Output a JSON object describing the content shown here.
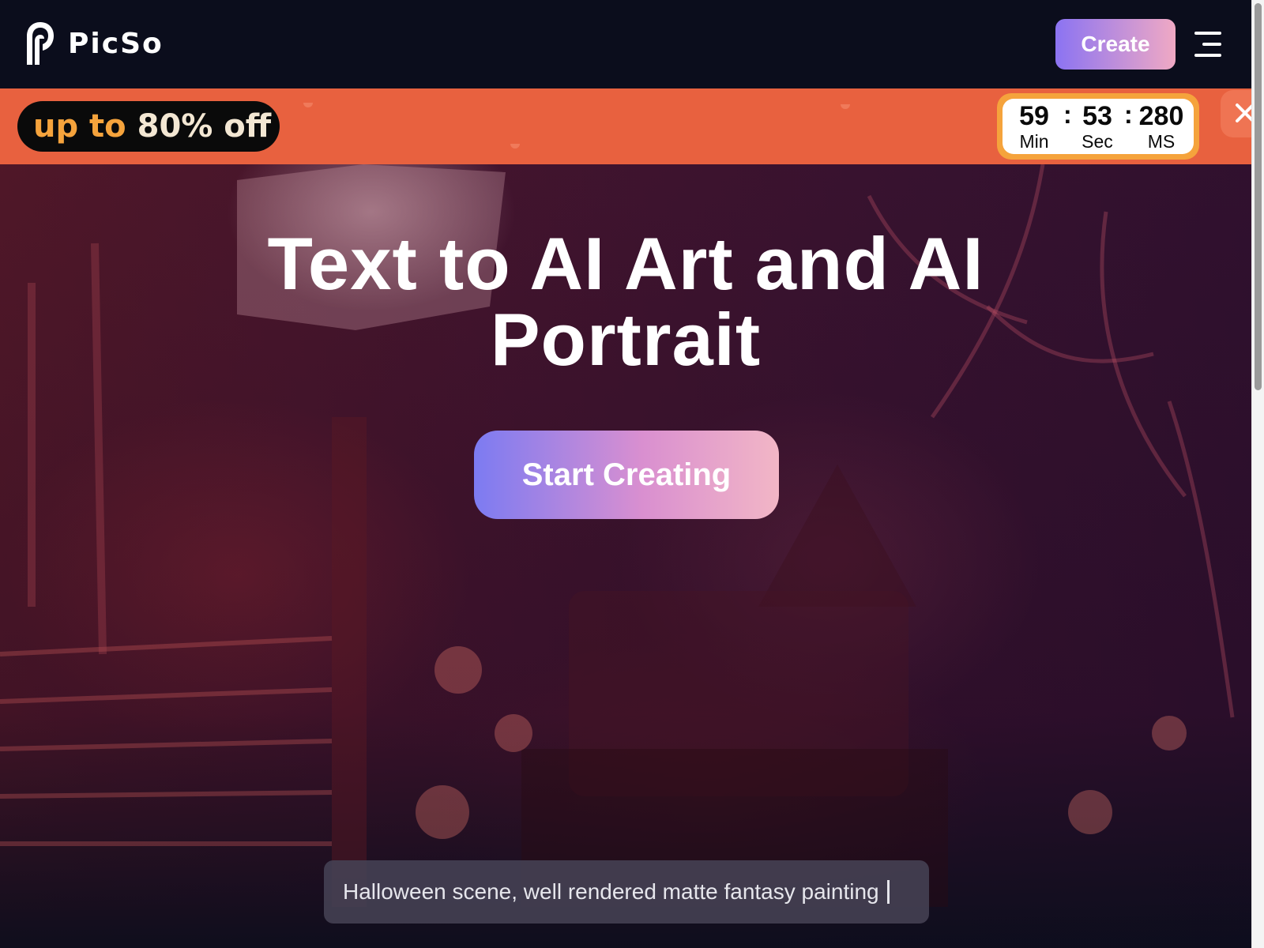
{
  "header": {
    "logo_text": "PicSo",
    "logo_icon": "picso-logo-icon",
    "create_label": "Create",
    "menu_icon": "menu-icon"
  },
  "promo": {
    "lead": "up to",
    "amount": "80% off",
    "countdown": {
      "minutes": "59",
      "seconds": "53",
      "milliseconds": "280",
      "separator": ":",
      "min_label": "Min",
      "sec_label": "Sec",
      "ms_label": "MS"
    },
    "close_icon": "close-icon"
  },
  "hero": {
    "title_line1": "Text to AI Art and AI",
    "title_line2": "Portrait",
    "cta_label": "Start Creating",
    "prompt_text": "Halloween scene, well rendered matte fantasy painting"
  },
  "colors": {
    "background": "#0b0d1c",
    "promo_orange": "#e8613f",
    "countdown_border": "#f5a33c",
    "button_gradient_start": "#8b73f2",
    "button_gradient_end": "#f0a9c4"
  }
}
